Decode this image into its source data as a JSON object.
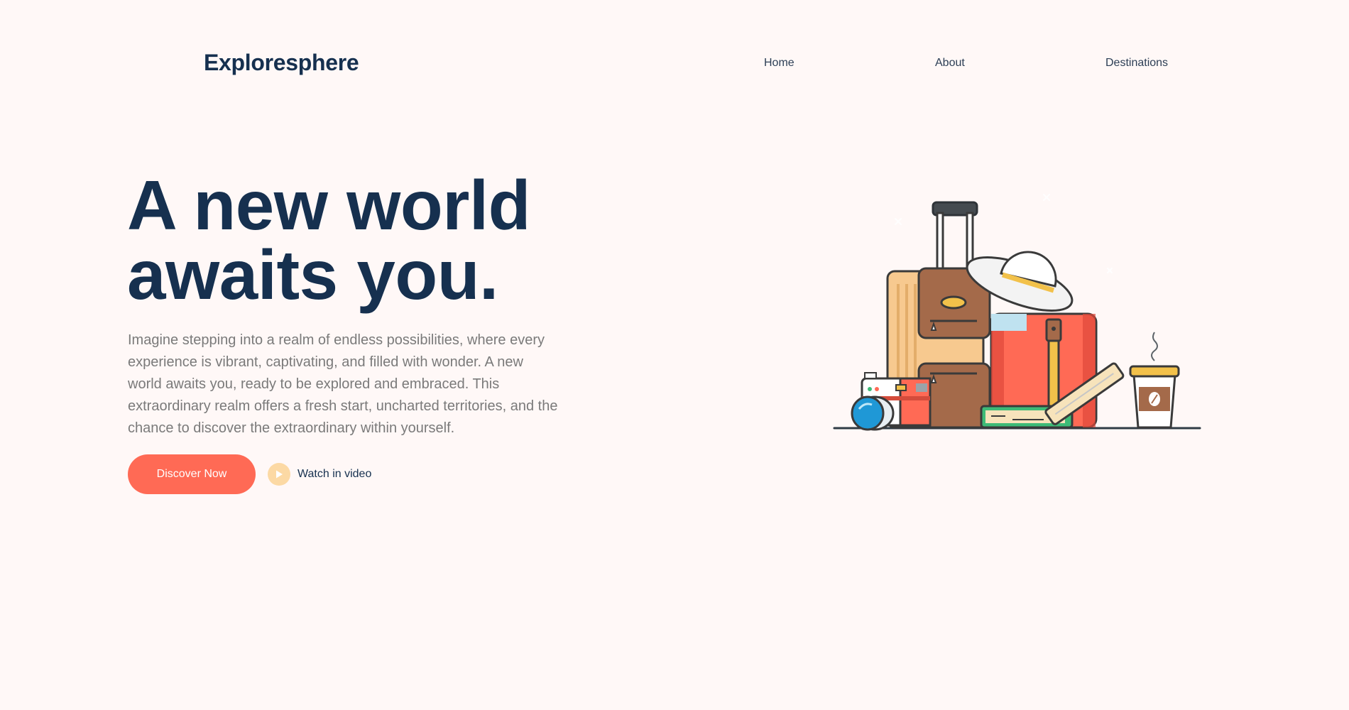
{
  "brand": {
    "name": "Exploresphere"
  },
  "nav": {
    "items": [
      {
        "label": "Home"
      },
      {
        "label": "About"
      },
      {
        "label": "Destinations"
      }
    ]
  },
  "hero": {
    "title_line1": "A new world",
    "title_line2": "awaits you.",
    "description": "Imagine stepping into a realm of endless possibilities, where every experience is vibrant, captivating, and filled with wonder. A new world awaits you, ready to be explored and embraced. This extraordinary realm offers a fresh start, uncharted territories, and the chance to discover the extraordinary within yourself.",
    "cta_label": "Discover Now",
    "video_label": "Watch in video"
  },
  "colors": {
    "background": "#fff8f7",
    "heading": "#16304f",
    "accent": "#ff6a55",
    "play_circle": "#fcd9a4"
  },
  "icons": {
    "play": "play-icon",
    "illustration": "travel-luggage-illustration"
  }
}
